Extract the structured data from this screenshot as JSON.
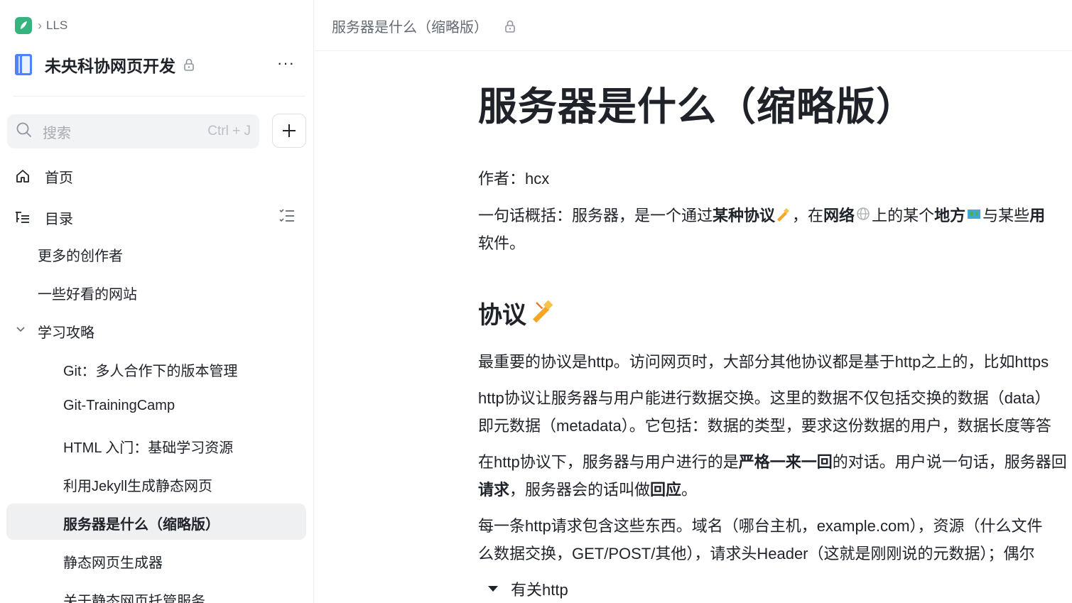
{
  "breadcrumb": {
    "item": "LLS"
  },
  "space": {
    "title": "未央科协网页开发",
    "more": "···"
  },
  "search": {
    "placeholder": "搜索",
    "shortcut": "Ctrl + J"
  },
  "nav": {
    "home": "首页",
    "toc": "目录"
  },
  "tree": {
    "items": [
      "更多的创作者",
      "一些好看的网站",
      "学习攻略",
      "Git：多人合作下的版本管理",
      "Git-TrainingCamp",
      "HTML 入门：基础学习资源",
      "利用Jekyll生成静态网页",
      "服务器是什么（缩略版）",
      "静态网页生成器",
      "关于静态网页托管服务"
    ]
  },
  "topbar": {
    "title": "服务器是什么（缩略版）"
  },
  "doc": {
    "title": "服务器是什么（缩略版）",
    "author": "作者：hcx",
    "summary": {
      "t1": "一句话概括：服务器，是一个通过",
      "b1": "某种协议",
      "t2": "，在",
      "b2": "网络",
      "t3": "上的某个",
      "b3": "地方",
      "t4": "与某些",
      "b4": "用",
      "line2": "软件。"
    },
    "h_protocol": "协议",
    "p1": "最重要的协议是http。访问网页时，大部分其他协议都是基于http之上的，比如https",
    "p2_l1": "http协议让服务器与用户能进行数据交换。这里的数据不仅包括交换的数据（data）",
    "p2_l2": "即元数据（metadata）。它包括：数据的类型，要求这份数据的用户，数据长度等答",
    "p3": {
      "t1": "在http协议下，服务器与用户进行的是",
      "b1": "严格一来一回",
      "t2": "的对话。用户说一句话，服务器回",
      "b2": "请求",
      "t3": "，服务器会的话叫做",
      "b3": "回应",
      "t4": "。"
    },
    "p4_l1": "每一条http请求包含这些东西。域名（哪台主机，example.com），资源（什么文件",
    "p4_l2": "么数据交换，GET/POST/其他），请求头Header（这就是刚刚说的元数据）；偶尔",
    "fold": "有关http"
  }
}
